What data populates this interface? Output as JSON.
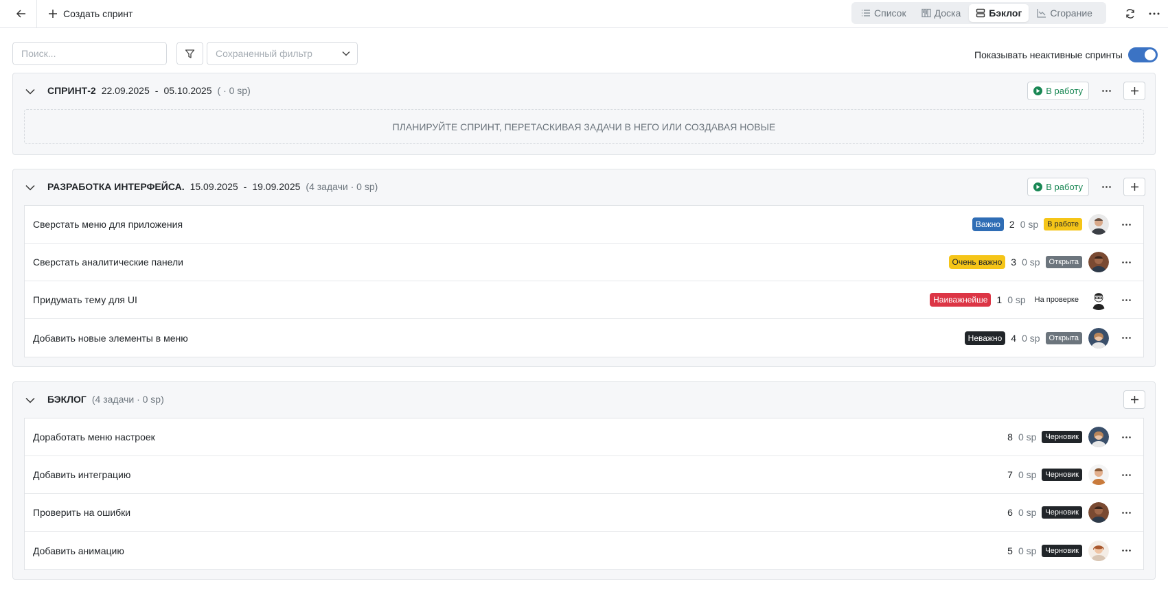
{
  "header": {
    "create_label": "Создать спринт",
    "views": [
      {
        "label": "Список",
        "icon": "list-icon",
        "active": false
      },
      {
        "label": "Доска",
        "icon": "board-icon",
        "active": false
      },
      {
        "label": "Бэклог",
        "icon": "backlog-icon",
        "active": true
      },
      {
        "label": "Сгорание",
        "icon": "burndown-chart-icon",
        "active": false
      }
    ]
  },
  "toolbar": {
    "search_placeholder": "Поиск...",
    "saved_filter_placeholder": "Сохраненный фильтр",
    "toggle_label": "Показывать неактивные спринты",
    "toggle_on": true
  },
  "sprints": [
    {
      "name": "Спринт-2",
      "start": "22.09.2025",
      "dash": "-",
      "end": "05.10.2025",
      "meta": "( · 0 sp)",
      "start_label": "В работу",
      "empty_text": "Планируйте спринт, перетаскивая задачи в него или создавая новые"
    },
    {
      "name": "Разработка интерфейса.",
      "start": "15.09.2025",
      "dash": "-",
      "end": "19.09.2025",
      "meta": "(4 задачи · 0 sp)",
      "start_label": "В работу",
      "tasks": [
        {
          "title": "Сверстать меню для приложения",
          "priority": "Важно",
          "prio_bg": "#2f6db5",
          "prio_fg": "#ffffff",
          "num": "2",
          "sp": "0 sp",
          "status": "В работе",
          "status_bg": "#f5c518",
          "status_fg": "#212529",
          "avatar": "avatar-1"
        },
        {
          "title": "Сверстать аналитические панели",
          "priority": "Очень важно",
          "prio_bg": "#f5c518",
          "prio_fg": "#212529",
          "num": "3",
          "sp": "0 sp",
          "status": "Открыта",
          "status_bg": "#6c757d",
          "status_fg": "#ffffff",
          "avatar": "avatar-2"
        },
        {
          "title": "Придумать тему для UI",
          "priority": "Наиважнейше",
          "prio_bg": "#dc3545",
          "prio_fg": "#ffffff",
          "num": "1",
          "sp": "0 sp",
          "status": "На проверке",
          "status_bg": "#ffffff",
          "status_fg": "#212529",
          "avatar": "avatar-3"
        },
        {
          "title": "Добавить новые элементы в меню",
          "priority": "Неважно",
          "prio_bg": "#212529",
          "prio_fg": "#ffffff",
          "num": "4",
          "sp": "0 sp",
          "status": "Открыта",
          "status_bg": "#6c757d",
          "status_fg": "#ffffff",
          "avatar": "avatar-4"
        }
      ]
    }
  ],
  "backlog": {
    "name": "Бэклог",
    "meta": "(4 задачи · 0 sp)",
    "tasks": [
      {
        "title": "Доработать меню настроек",
        "num": "8",
        "sp": "0 sp",
        "status": "Черновик",
        "avatar": "avatar-4"
      },
      {
        "title": "Добавить интеграцию",
        "num": "7",
        "sp": "0 sp",
        "status": "Черновик",
        "avatar": "avatar-5"
      },
      {
        "title": "Проверить на ошибки",
        "num": "6",
        "sp": "0 sp",
        "status": "Черновик",
        "avatar": "avatar-2"
      },
      {
        "title": "Добавить анимацию",
        "num": "5",
        "sp": "0 sp",
        "status": "Черновик",
        "avatar": "avatar-6"
      }
    ],
    "status_bg": "#212529",
    "status_fg": "#ffffff"
  },
  "colors": {
    "accent": "#3b73c4",
    "start_green": "#198754"
  }
}
